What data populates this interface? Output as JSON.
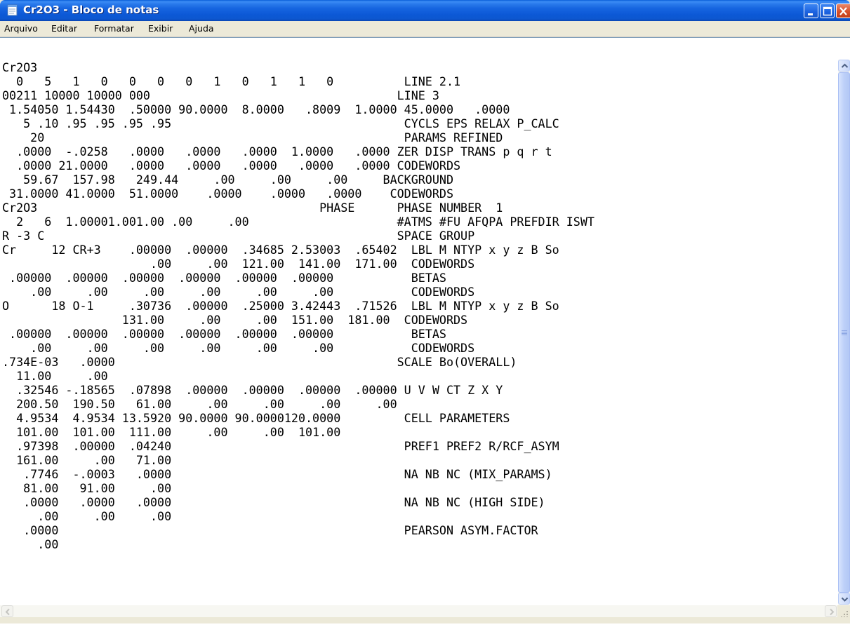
{
  "window": {
    "title": "Cr2O3 - Bloco de notas"
  },
  "menu": {
    "items": [
      "Arquivo",
      "Editar",
      "Formatar",
      "Exibir",
      "Ajuda"
    ]
  },
  "document": {
    "lines": [
      "Cr2O3",
      "  0   5   1   0   0   0   0   1   0   1   1   0          LINE 2.1",
      "00211 10000 10000 000                                   LINE 3",
      " 1.54050 1.54430  .50000 90.0000  8.0000   .8009  1.0000 45.0000   .0000",
      "   5 .10 .95 .95 .95 .95                                 CYCLS EPS RELAX P_CALC",
      "    20                                                   PARAMS REFINED",
      "  .0000  -.0258   .0000   .0000   .0000  1.0000   .0000 ZER DISP TRANS p q r t",
      "  .0000 21.0000   .0000   .0000   .0000   .0000   .0000 CODEWORDS",
      "   59.67  157.98   249.44     .00     .00     .00     BACKGROUND",
      " 31.0000 41.0000  51.0000    .0000    .0000   .0000    CODEWORDS",
      "Cr2O3                                        PHASE      PHASE NUMBER  1",
      "  2   6  1.00001.001.00 .00     .00                     #ATMS #FU AFQPA PREFDIR ISWT",
      "R -3 C                                                  SPACE GROUP",
      "Cr     12 CR+3    .00000  .00000  .34685 2.53003  .65402  LBL M NTYP x y z B So",
      "                     .00     .00  121.00  141.00  171.00  CODEWORDS",
      " .00000  .00000  .00000  .00000  .00000  .00000           BETAS",
      "    .00     .00     .00     .00     .00     .00           CODEWORDS",
      "O      18 O-1     .30736  .00000  .25000 3.42443  .71526  LBL M NTYP x y z B So",
      "                 131.00     .00     .00  151.00  181.00  CODEWORDS",
      " .00000  .00000  .00000  .00000  .00000  .00000           BETAS",
      "    .00     .00     .00     .00     .00     .00           CODEWORDS",
      ".734E-03   .0000                                        SCALE Bo(OVERALL)",
      "  11.00     .00",
      "  .32546 -.18565  .07898  .00000  .00000  .00000  .00000 U V W CT Z X Y",
      "  200.50  190.50   61.00     .00     .00     .00     .00",
      "  4.9534  4.9534 13.5920 90.0000 90.0000120.0000         CELL PARAMETERS",
      "  101.00  101.00  111.00     .00     .00  101.00",
      "  .97398  .00000  .04240                                 PREF1 PREF2 R/RCF_ASYM",
      "  161.00     .00   71.00",
      "   .7746  -.0003   .0000                                 NA NB NC (MIX_PARAMS)",
      "   81.00   91.00     .00",
      "   .0000   .0000   .0000                                 NA NB NC (HIGH SIDE)",
      "     .00     .00     .00",
      "   .0000                                                 PEARSON ASYM.FACTOR",
      "     .00"
    ]
  },
  "icons": {
    "app": "notepad-icon",
    "minimize": "minimize-icon",
    "maximize": "maximize-icon",
    "close": "close-icon",
    "scroll_up": "arrow-up-icon",
    "scroll_down": "arrow-down-icon",
    "scroll_left": "arrow-left-icon",
    "scroll_right": "arrow-right-icon"
  },
  "colors": {
    "titlebar": "#0c58d6",
    "close_button": "#d8502a",
    "menu_background": "#ece9d8",
    "text": "#000000"
  }
}
